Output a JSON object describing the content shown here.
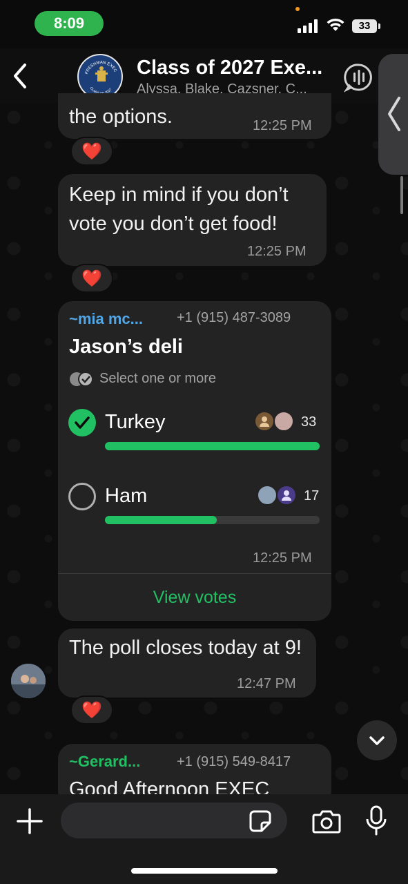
{
  "status_bar": {
    "time": "8:09",
    "battery": "33"
  },
  "header": {
    "title": "Class of 2027 Exe...",
    "members": "Alyssa, Blake, Cazsner, C...",
    "avatar_top_text": "FRESHMAN EXEC",
    "avatar_bottom_text": "CLASS OF 2027"
  },
  "messages": [
    {
      "text": "the options.",
      "time": "12:25 PM",
      "reaction": "❤️"
    },
    {
      "text": "Keep in mind if you don’t vote you don’t get food!",
      "time": "12:25 PM",
      "reaction": "❤️"
    }
  ],
  "poll": {
    "sender": "~mia mc...",
    "phone": "+1 (915) 487-3089",
    "title": "Jason’s deli",
    "subtitle": "Select one or more",
    "time": "12:25 PM",
    "view_votes": "View votes",
    "options": [
      {
        "label": "Turkey",
        "count": "33",
        "fraction": 1.0,
        "checked": true
      },
      {
        "label": "Ham",
        "count": "17",
        "fraction": 0.52,
        "checked": false
      }
    ]
  },
  "message_3": {
    "text": "The poll closes today at 9!",
    "time": "12:47 PM",
    "reaction": "❤️"
  },
  "message_4": {
    "sender": "~Gerard...",
    "phone": "+1 (915) 549-8417",
    "text_partial": "Good Afternoon EXEC"
  },
  "input": {
    "placeholder": ""
  },
  "colors": {
    "accent": "#21c063",
    "status_pill": "#2fb34e",
    "sender_blue": "#53a6e6",
    "bubble": "#232323"
  }
}
